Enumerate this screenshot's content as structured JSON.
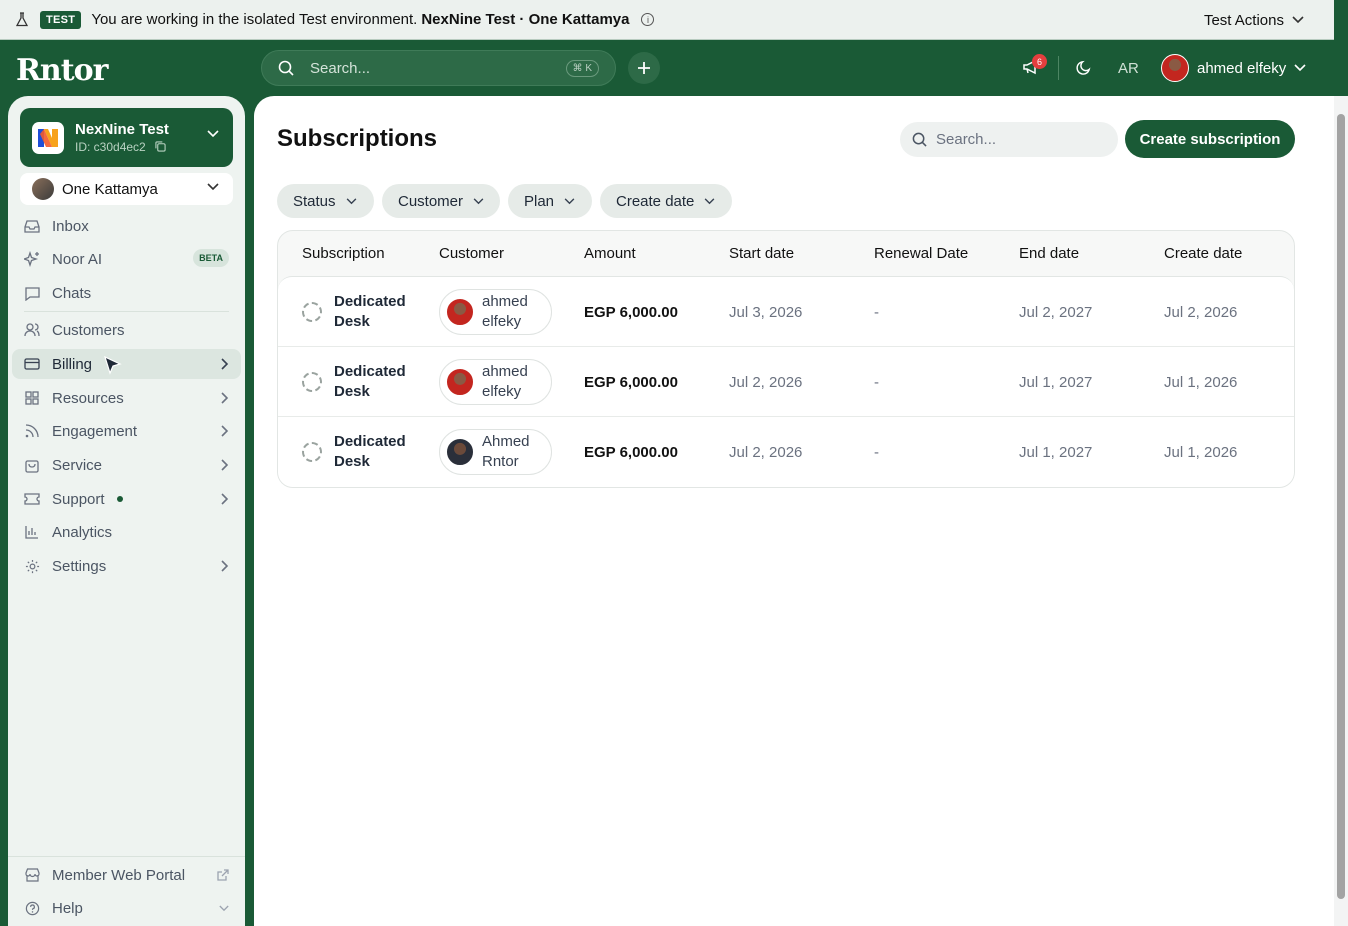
{
  "test_banner": {
    "badge": "TEST",
    "message": "You are working in the isolated Test environment.",
    "env": "NexNine Test · One Kattamya",
    "actions_label": "Test Actions"
  },
  "header": {
    "logo": "Rntor",
    "search_placeholder": "Search...",
    "shortcut": "⌘ K",
    "notifications_count": "6",
    "lang": "AR",
    "user_name": "ahmed elfeky"
  },
  "sidebar": {
    "org_name": "NexNine Test",
    "org_id": "ID: c30d4ec2",
    "location": "One Kattamya",
    "items": [
      {
        "label": "Inbox"
      },
      {
        "label": "Noor AI",
        "badge": "BETA"
      },
      {
        "label": "Chats"
      },
      {
        "label": "Customers"
      },
      {
        "label": "Billing"
      },
      {
        "label": "Resources"
      },
      {
        "label": "Engagement"
      },
      {
        "label": "Service"
      },
      {
        "label": "Support"
      },
      {
        "label": "Analytics"
      },
      {
        "label": "Settings"
      }
    ],
    "bottom": [
      {
        "label": "Member Web Portal"
      },
      {
        "label": "Help"
      }
    ]
  },
  "main": {
    "title": "Subscriptions",
    "search_placeholder": "Search...",
    "create_label": "Create subscription",
    "filters": [
      "Status",
      "Customer",
      "Plan",
      "Create date"
    ],
    "columns": [
      "Subscription",
      "Customer",
      "Amount",
      "Start date",
      "Renewal Date",
      "End date",
      "Create date"
    ],
    "rows": [
      {
        "sub1": "Dedicated",
        "sub2": "Desk",
        "c1": "ahmed",
        "c2": "elfeky",
        "amount": "EGP 6,000.00",
        "start": "Jul 3, 2026",
        "renewal": "-",
        "end": "Jul 2, 2027",
        "created": "Jul 2, 2026"
      },
      {
        "sub1": "Dedicated",
        "sub2": "Desk",
        "c1": "ahmed",
        "c2": "elfeky",
        "amount": "EGP 6,000.00",
        "start": "Jul 2, 2026",
        "renewal": "-",
        "end": "Jul 1, 2027",
        "created": "Jul 1, 2026"
      },
      {
        "sub1": "Dedicated",
        "sub2": "Desk",
        "c1": "Ahmed",
        "c2": "Rntor",
        "amount": "EGP 6,000.00",
        "start": "Jul 2, 2026",
        "renewal": "-",
        "end": "Jul 1, 2027",
        "created": "Jul 1, 2026"
      }
    ]
  },
  "colors": {
    "brand": "#1a5a36",
    "notification": "#e53e3e"
  }
}
